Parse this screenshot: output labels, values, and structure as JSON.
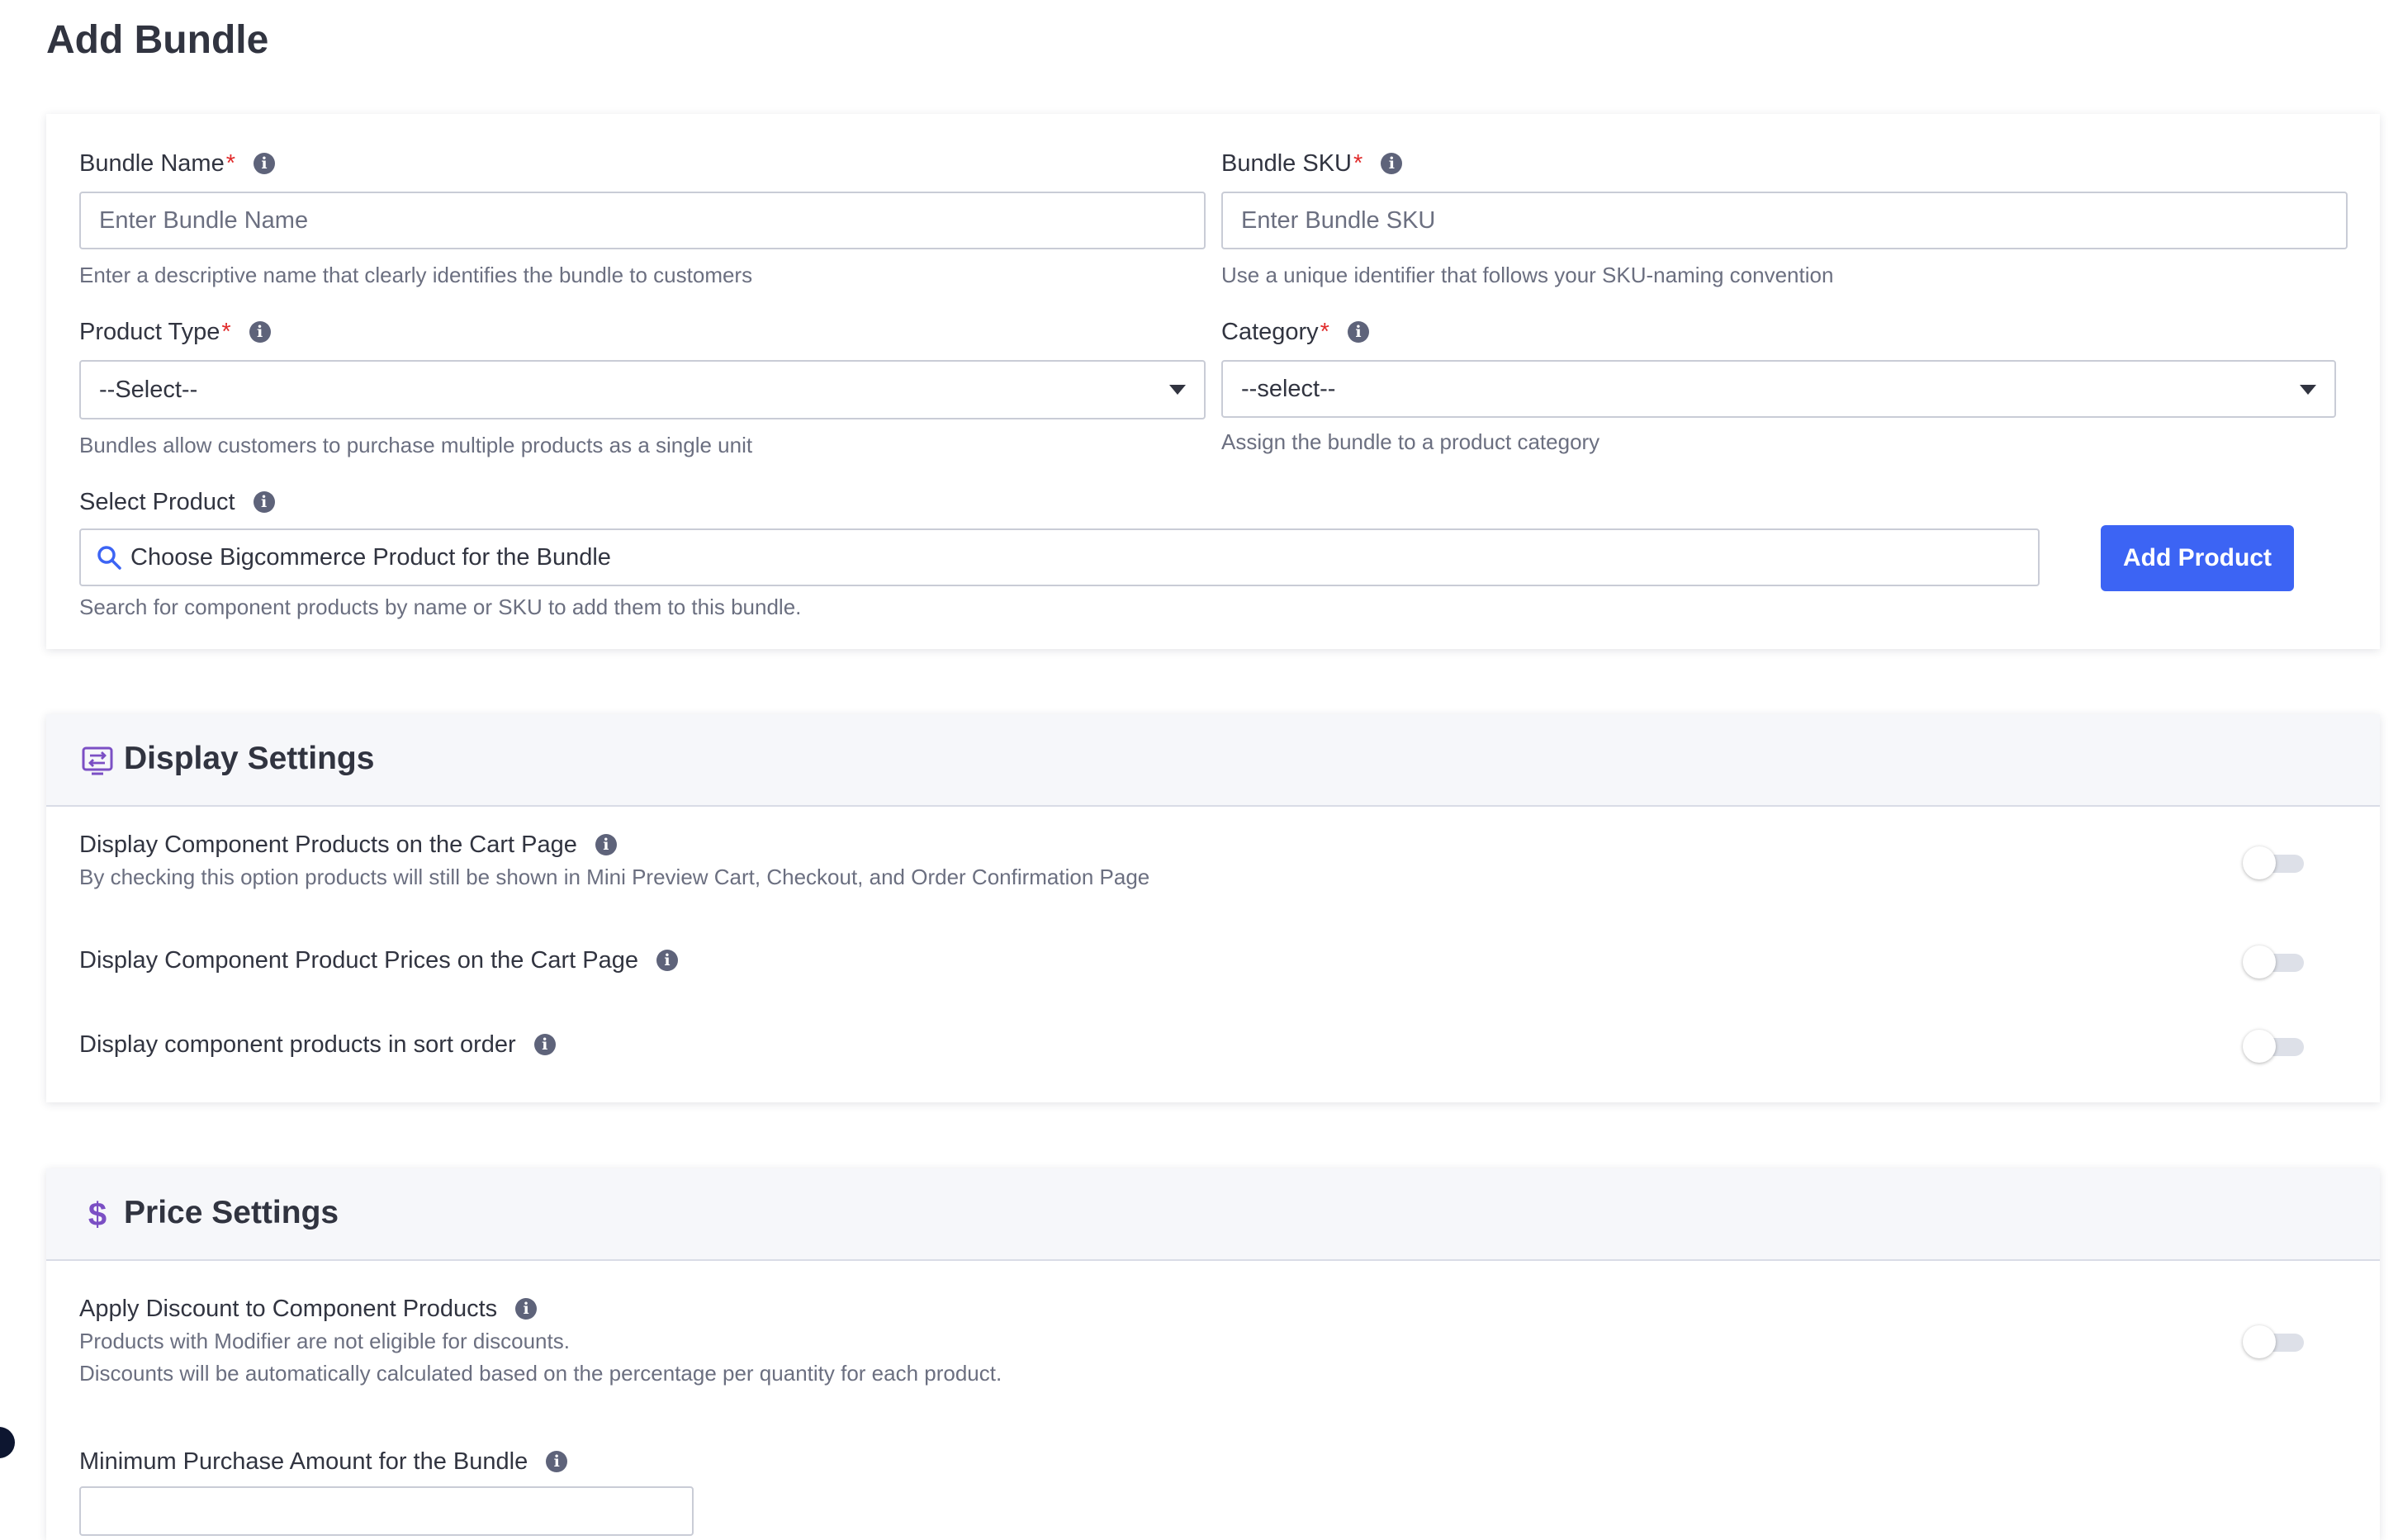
{
  "page": {
    "title": "Add Bundle"
  },
  "general": {
    "bundle_name": {
      "label": "Bundle Name",
      "required_mark": "*",
      "placeholder": "Enter Bundle Name",
      "help": "Enter a descriptive name that clearly identifies the bundle to customers"
    },
    "bundle_sku": {
      "label": "Bundle SKU",
      "required_mark": "*",
      "placeholder": "Enter Bundle SKU",
      "help": "Use a unique identifier that follows your SKU-naming convention"
    },
    "product_type": {
      "label": "Product Type",
      "required_mark": "*",
      "selected": "--Select--",
      "help": "Bundles allow customers to purchase multiple products as a single unit"
    },
    "category": {
      "label": "Category",
      "required_mark": "*",
      "selected": "--select--",
      "help": "Assign the bundle to a product category"
    },
    "select_product": {
      "label": "Select Product",
      "placeholder": "Choose Bigcommerce Product for the Bundle",
      "help": "Search for component products by name or SKU to add them to this bundle.",
      "button_label": "Add Product"
    },
    "info_glyph": "i"
  },
  "display_settings": {
    "title": "Display Settings",
    "icon": "display-settings-icon",
    "items": [
      {
        "label": "Display Component Products on the Cart Page",
        "description": "By checking this option products will still be shown in Mini Preview Cart, Checkout, and Order Confirmation Page",
        "enabled": false
      },
      {
        "label": "Display Component Product Prices on the Cart Page",
        "description": "",
        "enabled": false
      },
      {
        "label": "Display component products in sort order",
        "description": "",
        "enabled": false
      }
    ]
  },
  "price_settings": {
    "title": "Price Settings",
    "icon": "dollar-icon",
    "icon_glyph": "$",
    "apply_discount": {
      "label": "Apply Discount to Component Products",
      "description_1": "Products with Modifier are not eligible for discounts.",
      "description_2": "Discounts will be automatically calculated based on the percentage per quantity for each product.",
      "enabled": false
    },
    "min_purchase": {
      "label": "Minimum Purchase Amount for the Bundle"
    }
  },
  "colors": {
    "accent": "#3c64f4",
    "required": "#e12b2b",
    "section_icon": "#7b4fc4",
    "text": "#313440",
    "muted": "#6b6f80"
  }
}
